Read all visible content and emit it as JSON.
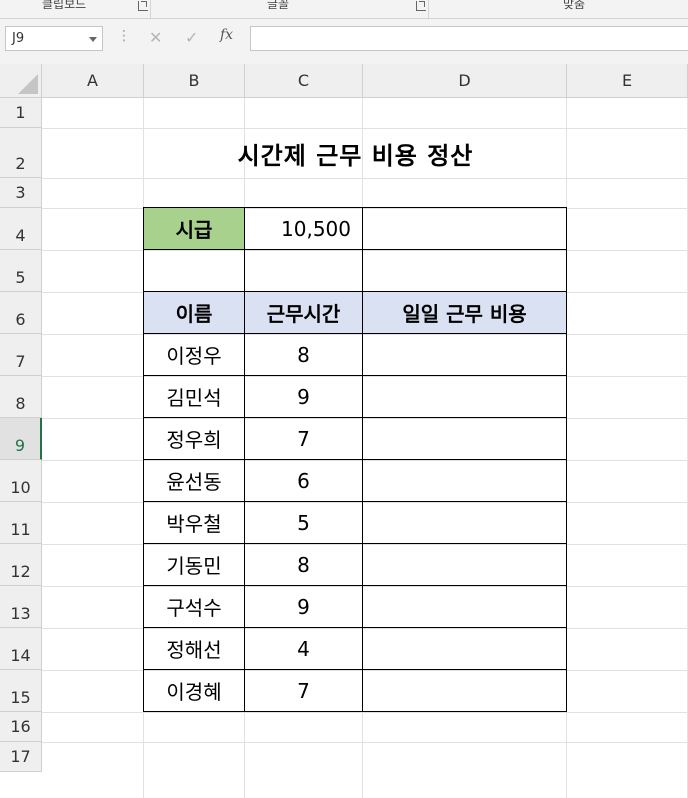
{
  "ribbon": {
    "groups": [
      "클립보드",
      "글꼴",
      "맞춤"
    ]
  },
  "formula_bar": {
    "name_box": "J9",
    "formula": "",
    "cancel_glyph": "✕",
    "enter_glyph": "✓",
    "fx_label": "fx"
  },
  "columns": [
    "A",
    "B",
    "C",
    "D",
    "E"
  ],
  "rows": [
    "1",
    "2",
    "3",
    "4",
    "5",
    "6",
    "7",
    "8",
    "9",
    "10",
    "11",
    "12",
    "13",
    "14",
    "15",
    "16",
    "17"
  ],
  "selected_row": "9",
  "sheet": {
    "title": "시간제 근무 비용 정산",
    "wage_label": "시급",
    "wage_value": "10,500",
    "headers": [
      "이름",
      "근무시간",
      "일일 근무 비용"
    ],
    "employees": [
      {
        "name": "이정우",
        "hours": "8",
        "cost": ""
      },
      {
        "name": "김민석",
        "hours": "9",
        "cost": ""
      },
      {
        "name": "정우희",
        "hours": "7",
        "cost": ""
      },
      {
        "name": "윤선동",
        "hours": "6",
        "cost": ""
      },
      {
        "name": "박우철",
        "hours": "5",
        "cost": ""
      },
      {
        "name": "기동민",
        "hours": "8",
        "cost": ""
      },
      {
        "name": "구석수",
        "hours": "9",
        "cost": ""
      },
      {
        "name": "정해선",
        "hours": "4",
        "cost": ""
      },
      {
        "name": "이경혜",
        "hours": "7",
        "cost": ""
      }
    ]
  },
  "colors": {
    "wage_label_fill": "#a9d18e",
    "header_fill": "#d9e1f2",
    "selection_accent": "#217346"
  }
}
